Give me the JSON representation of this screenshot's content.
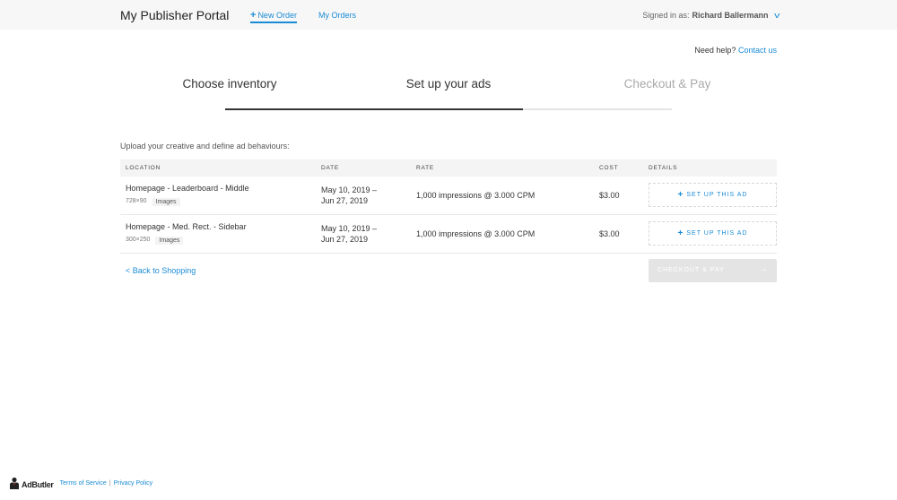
{
  "header": {
    "brand": "My Publisher Portal",
    "nav_new_order": "New Order",
    "nav_my_orders": "My Orders",
    "signed_in_label": "Signed in as:",
    "user_name": "Richard Ballermann"
  },
  "help": {
    "text": "Need help?",
    "link": "Contact us"
  },
  "steps": [
    {
      "label": "Choose inventory"
    },
    {
      "label": "Set up your ads"
    },
    {
      "label": "Checkout & Pay"
    }
  ],
  "progress": {
    "completed_steps": 2,
    "total_steps": 3
  },
  "intro": "Upload your creative and define ad behaviours:",
  "table": {
    "columns": [
      "LOCATION",
      "DATE",
      "RATE",
      "COST",
      "DETAILS"
    ],
    "rows": [
      {
        "location": "Homepage - Leaderboard - Middle",
        "size": "728×90",
        "type": "Images",
        "date_line1": "May 10, 2019 –",
        "date_line2": "Jun 27, 2019",
        "rate": "1,000 impressions @ 3.000 CPM",
        "cost": "$3.00",
        "action": "SET UP THIS AD"
      },
      {
        "location": "Homepage - Med. Rect. - Sidebar",
        "size": "300×250",
        "type": "Images",
        "date_line1": "May 10, 2019 –",
        "date_line2": "Jun 27, 2019",
        "rate": "1,000 impressions @ 3.000 CPM",
        "cost": "$3.00",
        "action": "SET UP THIS AD"
      }
    ]
  },
  "back_link": "< Back to Shopping",
  "checkout_button": "CHECKOUT & PAY",
  "footer": {
    "logo_name": "AdButler",
    "terms": "Terms of Service",
    "privacy": "Privacy Policy"
  },
  "colors": {
    "accent": "#1a8bd5",
    "topbar_bg": "#f7f7f7",
    "disabled_button": "#e4e4e4"
  },
  "icons": {
    "new_order": "plus-icon",
    "user_menu": "chevron-down-icon",
    "setup": "plus-icon",
    "checkout": "arrow-right-icon"
  }
}
